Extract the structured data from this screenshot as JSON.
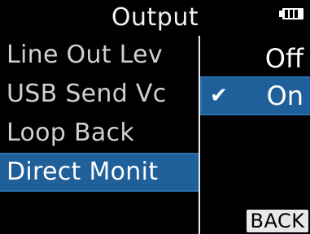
{
  "header": {
    "title": "Output",
    "battery_icon": "battery-icon"
  },
  "menu": {
    "items": [
      {
        "label": "Line Out Lev",
        "selected": false
      },
      {
        "label": "USB Send Vc",
        "selected": false
      },
      {
        "label": "Loop Back",
        "selected": false
      },
      {
        "label": "Direct Monit",
        "selected": true
      }
    ]
  },
  "options": {
    "items": [
      {
        "label": "Off",
        "selected": false
      },
      {
        "label": "On",
        "selected": true,
        "icon": "check-icon"
      }
    ]
  },
  "footer": {
    "back_label": "BACK"
  },
  "colors": {
    "background": "#000000",
    "selection": "#1f5f9a",
    "text": "#ffffff"
  }
}
